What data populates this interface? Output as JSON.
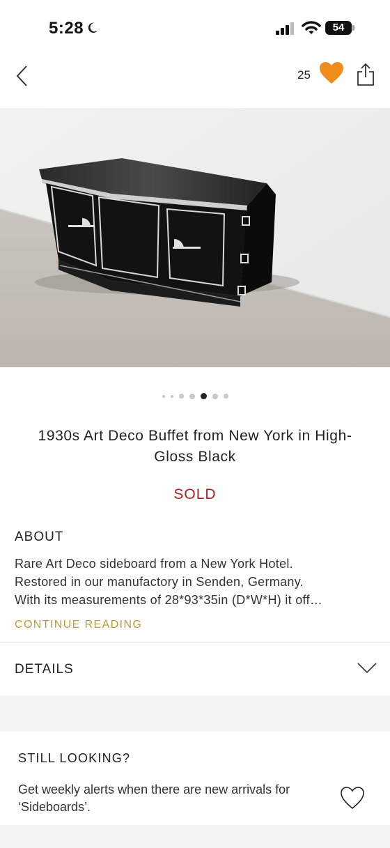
{
  "status_bar": {
    "time": "5:28",
    "battery": "54"
  },
  "nav": {
    "favorites_count": "25"
  },
  "carousel": {
    "count": 7,
    "active": 4
  },
  "product": {
    "title_line1": "1930s Art Deco Buffet from New York in High-",
    "title_line2": "Gloss Black",
    "status": "SOLD"
  },
  "about": {
    "heading": "ABOUT",
    "line1": "Rare Art Deco sideboard from a New York Hotel.",
    "line2": "Restored in our manufactory in Senden, Germany.",
    "line3": "With its measurements of 28*93*35in (D*W*H) it off…",
    "continue": "CONTINUE READING"
  },
  "details": {
    "heading": "DETAILS"
  },
  "still_looking": {
    "heading": "STILL LOOKING?",
    "line1": "Get weekly alerts when there are new arrivals for",
    "line2": "‘Sideboards’."
  },
  "colors": {
    "accent_heart": "#f08c1a",
    "sold": "#b0201f",
    "continue": "#b3a039"
  }
}
